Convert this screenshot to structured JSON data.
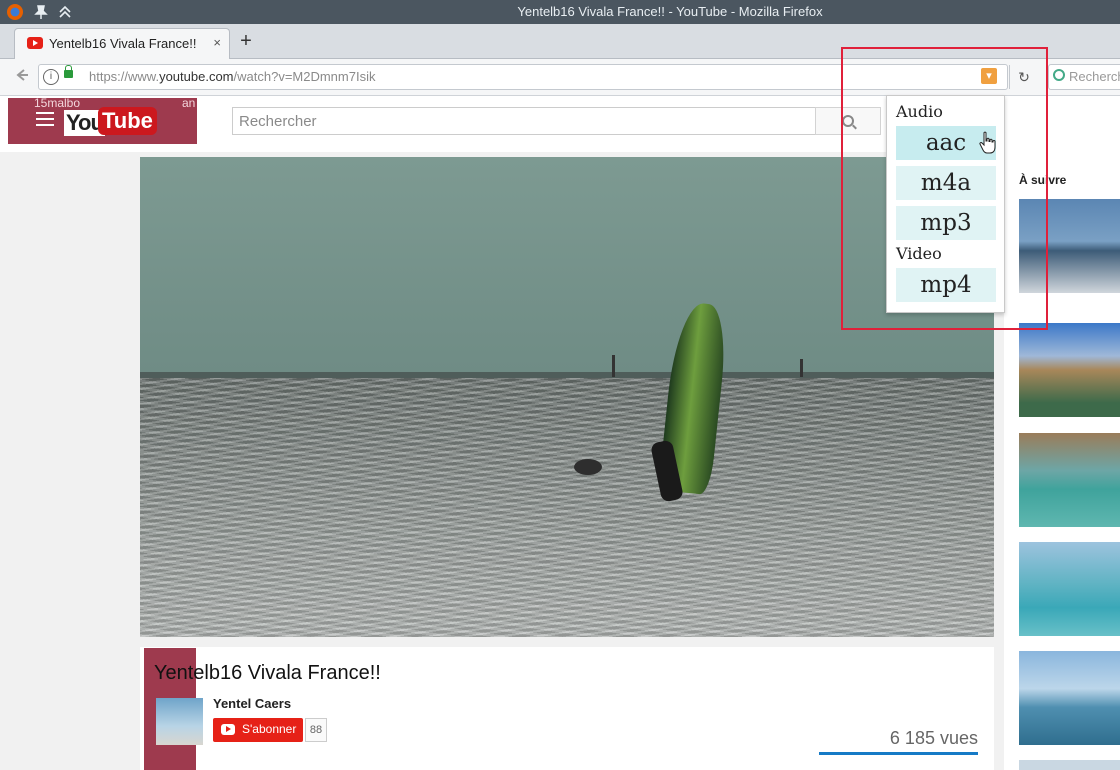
{
  "window": {
    "title": "Yentelb16 Vivala France!! - YouTube - Mozilla Firefox"
  },
  "tab": {
    "label": "Yentelb16 Vivala France!!",
    "close": "×",
    "new_tab": "+"
  },
  "navbar": {
    "url_prefix": "https://www.",
    "url_domain": "youtube.com",
    "url_path": "/watch?v=M2Dmnm7Isik",
    "search_placeholder": "Rechercher"
  },
  "masthead": {
    "logo_you": "You",
    "logo_tube": "Tube",
    "overlay_text_left": "15malbo",
    "overlay_text_right": "an",
    "search_placeholder": "Rechercher"
  },
  "video": {
    "title": "Yentelb16 Vivala France!!",
    "channel": "Yentel Caers",
    "subscribe_label": "S'abonner",
    "subscriber_count": "88",
    "views": "6 185 vues"
  },
  "sidebar": {
    "heading": "À suivre"
  },
  "extension_popup": {
    "audio_header": "Audio",
    "audio_formats": [
      "aac",
      "m4a",
      "mp3"
    ],
    "video_header": "Video",
    "video_formats": [
      "mp4"
    ]
  },
  "colors": {
    "youtube_red": "#cc181e",
    "subscribe_red": "#e62117",
    "highlight_red": "#e0203a",
    "format_bg": "#e0f3f4"
  }
}
